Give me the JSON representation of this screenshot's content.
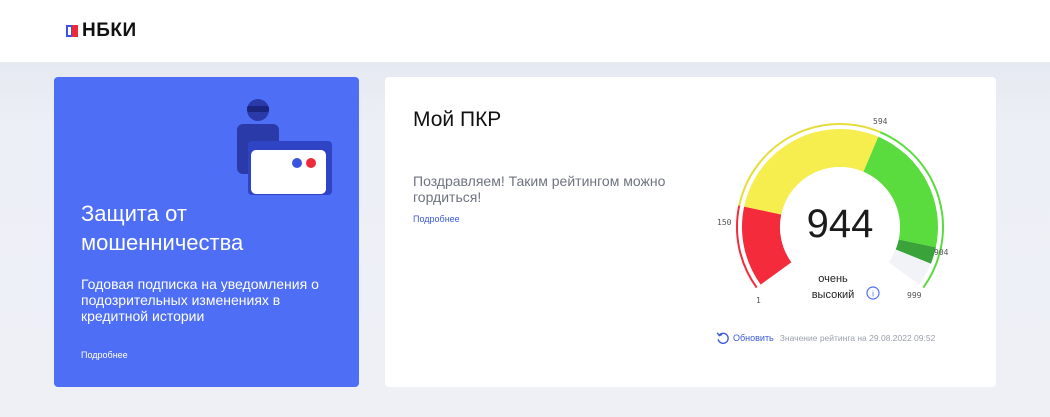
{
  "header": {
    "logo_text": "НБКИ"
  },
  "promo": {
    "title": "Защита от мошенничества",
    "description": "Годовая подписка на уведомления о подозрительных изменениях в кредитной истории",
    "more_link": "Подробнее"
  },
  "rating": {
    "title": "Мой ПКР",
    "message": "Поздравляем! Таким рейтингом можно гордиться!",
    "more_link": "Подробнее",
    "score": "944",
    "level_line1": "очень",
    "level_line2": "высокий",
    "scale_labels": {
      "min": "1",
      "low": "150",
      "mid": "594",
      "high": "904",
      "max": "999"
    },
    "refresh_label": "Обновить",
    "date_text": "Значение рейтинга на 29.08.2022 09:52",
    "colors": {
      "red": "#f42b3a",
      "yellow": "#f6ee4e",
      "green": "#5bdc3e",
      "dark_green": "#3aa33a"
    }
  }
}
